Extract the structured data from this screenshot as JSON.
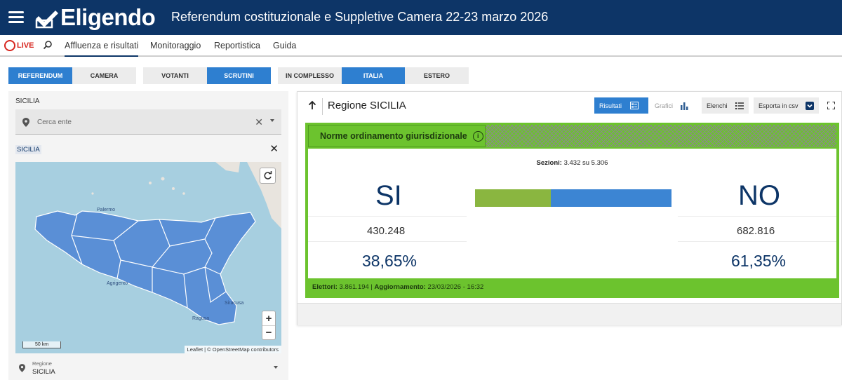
{
  "header": {
    "logo_text": "Eligendo",
    "title": "Referendum costituzionale e Suppletive Camera 22-23 marzo 2026"
  },
  "nav": {
    "live": "LIVE",
    "items": [
      "Affluenza e risultati",
      "Monitoraggio",
      "Reportistica",
      "Guida"
    ]
  },
  "filters": {
    "group1": [
      "REFERENDUM",
      "CAMERA"
    ],
    "group2": [
      "VOTANTI",
      "SCRUTINI"
    ],
    "group3": [
      "IN COMPLESSO",
      "ITALIA",
      "ESTERO"
    ]
  },
  "left_panel": {
    "label": "SICILIA",
    "search_placeholder": "Cerca ente",
    "selected_chip": "SICILIA",
    "scale": "50 km",
    "attribution": "Leaflet | © OpenStreetMap contributors",
    "region_label": "Regione",
    "region_value": "SICILIA",
    "map_labels": {
      "palermo": "Palermo",
      "agrigento": "Agrigento",
      "ragusa": "Ragusa",
      "siracusa": "Siracusa"
    }
  },
  "right_panel": {
    "title": "Regione SICILIA",
    "buttons": {
      "risultati": "Risultati",
      "grafici": "Grafici",
      "elenchi": "Elenchi",
      "csv": "Esporta in csv"
    },
    "question": "Norme ordinamento giurisdizionale",
    "sezioni_label": "Sezioni:",
    "sezioni_value": "3.432 su 5.306",
    "si": {
      "label": "SI",
      "votes": "430.248",
      "pct": "38,65%",
      "share": 0.3865
    },
    "no": {
      "label": "NO",
      "votes": "682.816",
      "pct": "61,35%",
      "share": 0.6135
    },
    "elettori_label": "Elettori:",
    "elettori_value": "3.861.194",
    "aggiornamento_label": "Aggiornamento:",
    "aggiornamento_value": "23/03/2026 - 16:32"
  },
  "colors": {
    "header": "#0d3567",
    "accent": "#2e7fd0",
    "si_bar": "#8ab640",
    "no_bar": "#3c85d3",
    "card": "#6cc32e",
    "live": "#d7261f"
  }
}
